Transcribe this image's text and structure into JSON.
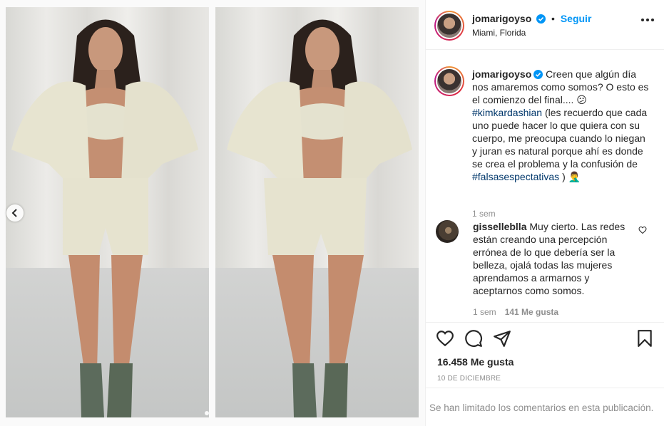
{
  "post": {
    "username": "jomarigoyso",
    "follow_label": "Seguir",
    "location": "Miami, Florida",
    "caption": {
      "text_1": "Creen que algún día nos amaremos como somos? O esto es el comienzo del final.... 😕",
      "hashtag_1": "#kimkardashian",
      "text_2": " (les recuerdo que cada uno puede hacer lo que quiera con su cuerpo, me preocupa cuando lo niegan y juran es natural porque ahí es donde se crea el problema y la confusión de ",
      "hashtag_2": "#falsasespectativas",
      "text_3": " ) 🤦‍♂️",
      "time": "1 sem"
    },
    "comments": [
      {
        "username": "gisselleblla",
        "text": " Muy cierto. Las redes están creando una percepción errónea de lo que debería ser la belleza, ojalá todas las mujeres aprendamos a armarnos y aceptarnos como somos.",
        "time": "1 sem",
        "likes": "141 Me gusta"
      }
    ],
    "likes": "16.458 Me gusta",
    "date": "10 DE DICIEMBRE",
    "comments_limited": "Se han limitado los comentarios en esta publicación."
  },
  "icons": {
    "prev": "chevron-left-icon",
    "verified": "verified-badge-icon",
    "more": "more-options-icon",
    "like": "heart-icon",
    "comment": "comment-icon",
    "share": "share-icon",
    "save": "bookmark-icon"
  },
  "colors": {
    "accent": "#0095f6",
    "hashtag": "#00376b",
    "muted": "#8e8e8e"
  }
}
